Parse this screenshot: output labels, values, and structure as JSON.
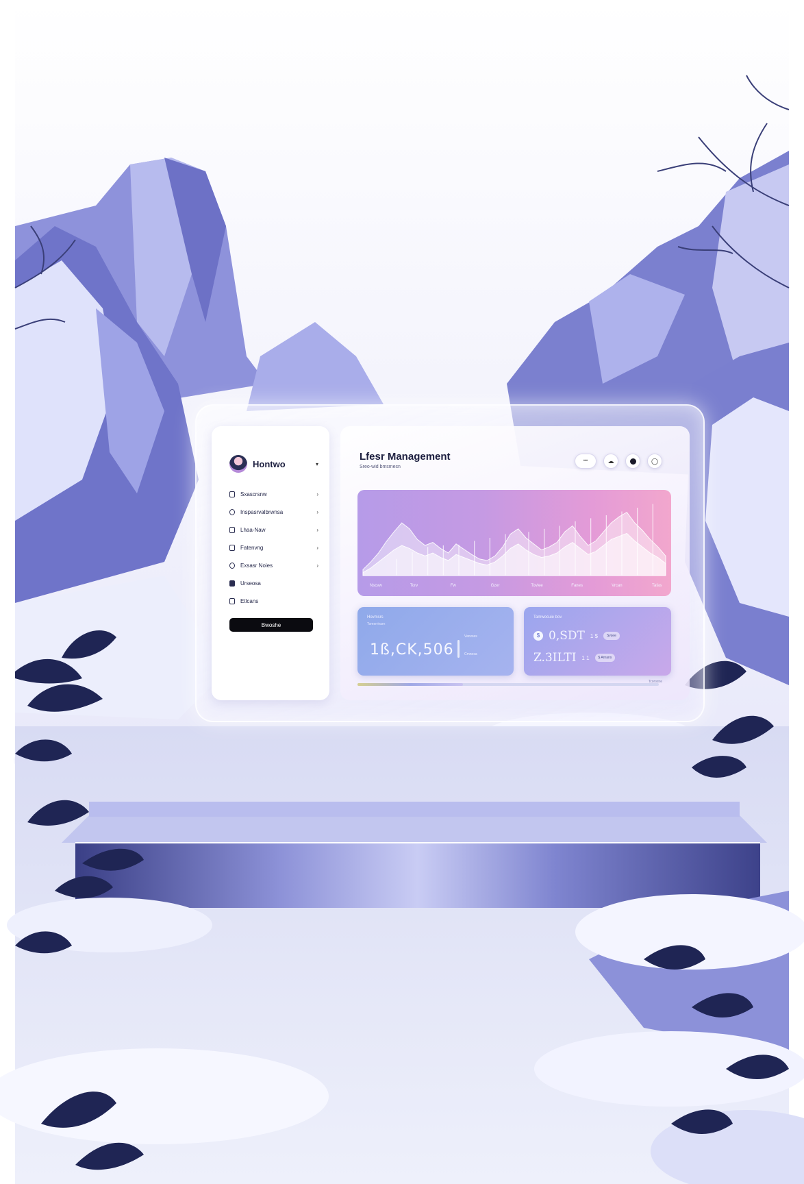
{
  "colors": {
    "sky": "#f1f0fb",
    "mountain_dark": "#6b6fc9",
    "mountain_mid": "#8f93dd",
    "mountain_light": "#c9cbf2",
    "snow": "#f7f8ff",
    "leaf": "#1f2554",
    "accent_pink": "#e9a0d8",
    "accent_purple": "#b69be8"
  },
  "sidebar": {
    "profile_name": "Hontwo",
    "profile_caret": "▾",
    "items": [
      {
        "label": "Sxascrsnw",
        "icon": "lock-icon",
        "chevron": "›"
      },
      {
        "label": "Inspasrvalbrwnsa",
        "icon": "user-icon",
        "chevron": "›"
      },
      {
        "label": "Lhaa-Naw",
        "icon": "document-icon",
        "chevron": "›"
      },
      {
        "label": "Fatenvng",
        "icon": "folder-icon",
        "chevron": "›"
      },
      {
        "label": "Exsasr Noies",
        "icon": "clock-icon",
        "chevron": "›"
      },
      {
        "label": "Urseosa",
        "icon": "file-icon",
        "chevron": ""
      },
      {
        "label": "Etlcans",
        "icon": "settings-icon",
        "chevron": ""
      }
    ],
    "button_label": "Bwoshe"
  },
  "header": {
    "title": "Lfesr Management",
    "subtitle": "Sreo-wid bmsmesn",
    "actions": [
      {
        "name": "status-pill",
        "label": "•••"
      },
      {
        "name": "cloud-icon",
        "label": "☁"
      },
      {
        "name": "record-icon",
        "label": ""
      },
      {
        "name": "user-circle-icon",
        "label": "◯"
      }
    ]
  },
  "chart_data": {
    "type": "area",
    "title": "",
    "xlabel": "",
    "ylabel": "",
    "x": [
      0,
      1,
      2,
      3,
      4,
      5,
      6,
      7,
      8,
      9,
      10,
      11,
      12,
      13,
      14,
      15,
      16,
      17,
      18,
      19,
      20,
      21,
      22,
      23,
      24,
      25,
      26,
      27,
      28,
      29,
      30,
      31,
      32,
      33,
      34,
      35,
      36,
      37,
      38,
      39
    ],
    "ylim": [
      0,
      100
    ],
    "series": [
      {
        "values": [
          8,
          18,
          30,
          45,
          58,
          70,
          62,
          48,
          40,
          44,
          36,
          30,
          42,
          35,
          28,
          22,
          20,
          26,
          38,
          55,
          62,
          50,
          42,
          34,
          38,
          44,
          58,
          66,
          52,
          40,
          46,
          58,
          70,
          78,
          84,
          70,
          60,
          48,
          38,
          26
        ]
      },
      {
        "values": [
          4,
          10,
          18,
          26,
          34,
          40,
          36,
          30,
          26,
          30,
          24,
          20,
          28,
          24,
          20,
          16,
          14,
          18,
          26,
          36,
          42,
          34,
          28,
          24,
          26,
          30,
          38,
          44,
          36,
          28,
          32,
          40,
          48,
          52,
          56,
          46,
          38,
          30,
          24,
          16
        ]
      }
    ],
    "spikes": [
      22,
      31,
      38,
      40,
      41,
      46,
      50,
      55,
      58,
      62,
      66,
      72,
      76,
      80,
      85,
      90,
      95
    ],
    "tick_labels": [
      "Nscvw",
      "Torv",
      "Fw",
      "Gzer",
      "Tovlee",
      "Fanes",
      "Vrcan",
      "Tafas"
    ]
  },
  "stats_left": {
    "label": "Hovmsrs",
    "sublabel": "Tomerrivarn",
    "value": "1ß,CK,506",
    "bar_level": 0.85,
    "note_top": "Vanvses",
    "note_bottom": "Cmnosa"
  },
  "stats_right": {
    "header": "Tamwocuie bov",
    "coin_symbol": "$",
    "row1_big": "0,SDT",
    "row1_small": "1 $",
    "row1_pill": "Svsee",
    "row2_big": "Z.3ILTI",
    "row2_small": "1 1",
    "row2_pill": "$ Anrans"
  },
  "progress": {
    "value": 0.35,
    "label": "Tconsrne"
  }
}
